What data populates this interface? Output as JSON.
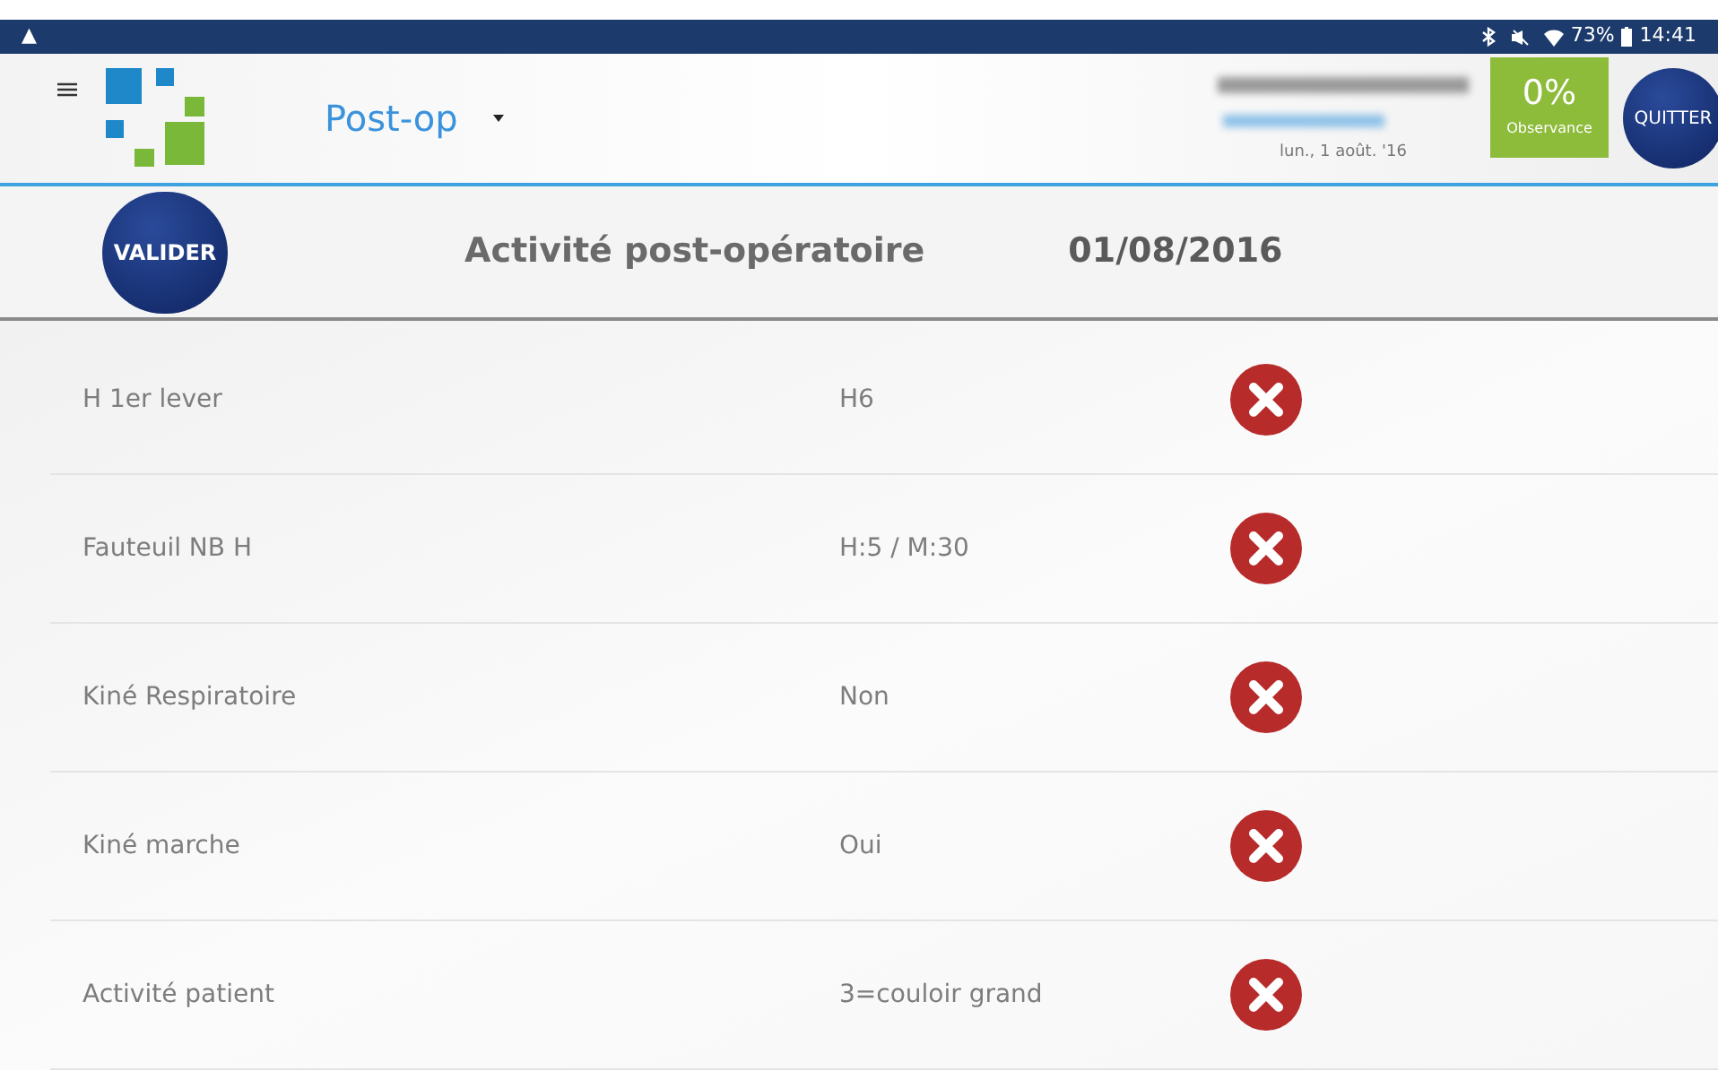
{
  "status_bar": {
    "warning": "▲",
    "battery": "73%",
    "time": "14:41"
  },
  "header": {
    "module": "Post-op",
    "date": "lun., 1 août. '16",
    "observance": {
      "value": "0%",
      "label": "Observance"
    },
    "quit": "QUITTER"
  },
  "title_bar": {
    "validate": "VALIDER",
    "title": "Activité post-opératoire",
    "date": "01/08/2016"
  },
  "rows": [
    {
      "label": "H 1er lever",
      "value": "H6",
      "valid": false
    },
    {
      "label": "Fauteuil NB H",
      "value": "H:5 / M:30",
      "valid": false
    },
    {
      "label": "Kiné Respiratoire",
      "value": "Non",
      "valid": false
    },
    {
      "label": "Kiné marche",
      "value": "Oui",
      "valid": false
    },
    {
      "label": "Activité patient",
      "value": "3=couloir grand",
      "valid": false
    }
  ]
}
